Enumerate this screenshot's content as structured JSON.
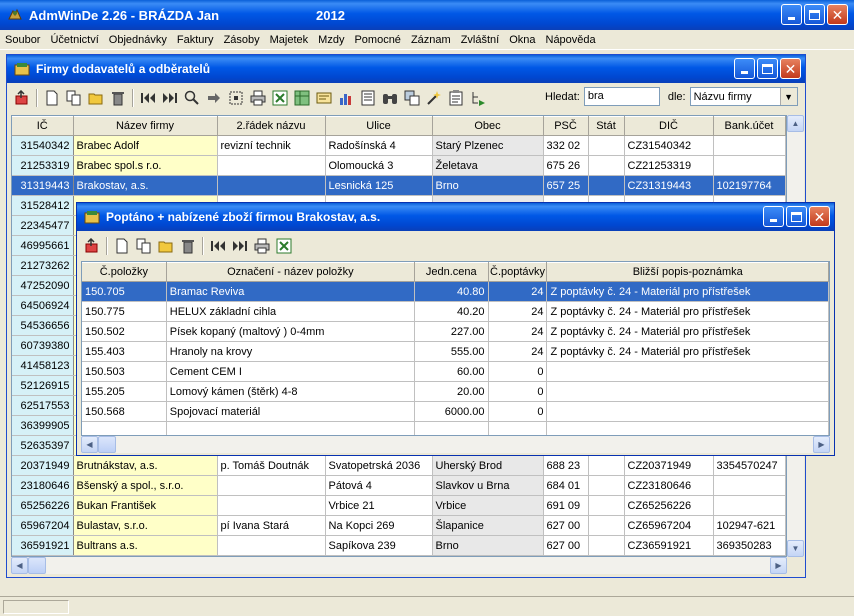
{
  "app": {
    "title": "AdmWinDe 2.26 - BRÁZDA Jan",
    "year": "2012"
  },
  "menu": [
    "Soubor",
    "Účetnictví",
    "Objednávky",
    "Faktury",
    "Zásoby",
    "Majetek",
    "Mzdy",
    "Pomocné",
    "Záznam",
    "Zvláštní",
    "Okna",
    "Nápověda"
  ],
  "firms_window": {
    "title": "Firmy dodavatelů a odběratelů",
    "search_label": "Hledat:",
    "search_value": "bra",
    "by_label": "dle:",
    "by_value": "Názvu firmy",
    "columns": [
      "IČ",
      "Název firmy",
      "2.řádek názvu",
      "Ulice",
      "Obec",
      "PSČ",
      "Stát",
      "DIČ",
      "Bank.účet"
    ],
    "rows": [
      {
        "ic": "31540342",
        "name": "Brabec Adolf",
        "line2": "revizní technik",
        "street": "Radošínská 4",
        "city": "Starý Plzenec",
        "psc": "332 02",
        "stat": "",
        "dic": "CZ31540342",
        "bank": "",
        "selected": false
      },
      {
        "ic": "21253319",
        "name": "Brabec spol.s r.o.",
        "line2": "",
        "street": "Olomoucká 3",
        "city": "Želetava",
        "psc": "675 26",
        "stat": "",
        "dic": "CZ21253319",
        "bank": "",
        "selected": false
      },
      {
        "ic": "31319443",
        "name": "Brakostav, a.s.",
        "line2": "",
        "street": "Lesnická 125",
        "city": "Brno",
        "psc": "657 25",
        "stat": "",
        "dic": "CZ31319443",
        "bank": "102197764",
        "selected": true
      },
      {
        "ic": "31528412",
        "name": "",
        "line2": "",
        "street": "",
        "city": "",
        "psc": "",
        "stat": "",
        "dic": "",
        "bank": "",
        "selected": false
      },
      {
        "ic": "22345477",
        "name": "",
        "line2": "",
        "street": "",
        "city": "",
        "psc": "",
        "stat": "",
        "dic": "",
        "bank": "",
        "selected": false
      },
      {
        "ic": "46995661",
        "name": "",
        "line2": "",
        "street": "",
        "city": "",
        "psc": "",
        "stat": "",
        "dic": "",
        "bank": "",
        "selected": false
      },
      {
        "ic": "21273262",
        "name": "",
        "line2": "",
        "street": "",
        "city": "",
        "psc": "",
        "stat": "",
        "dic": "",
        "bank": "",
        "selected": false
      },
      {
        "ic": "47252090",
        "name": "",
        "line2": "",
        "street": "",
        "city": "",
        "psc": "",
        "stat": "",
        "dic": "",
        "bank": "",
        "selected": false
      },
      {
        "ic": "64506924",
        "name": "",
        "line2": "",
        "street": "",
        "city": "",
        "psc": "",
        "stat": "",
        "dic": "",
        "bank": "",
        "selected": false
      },
      {
        "ic": "54536656",
        "name": "",
        "line2": "",
        "street": "",
        "city": "",
        "psc": "",
        "stat": "",
        "dic": "",
        "bank": "",
        "selected": false
      },
      {
        "ic": "60739380",
        "name": "",
        "line2": "",
        "street": "",
        "city": "",
        "psc": "",
        "stat": "",
        "dic": "",
        "bank": "",
        "selected": false
      },
      {
        "ic": "41458123",
        "name": "",
        "line2": "",
        "street": "",
        "city": "",
        "psc": "",
        "stat": "",
        "dic": "",
        "bank": "",
        "selected": false
      },
      {
        "ic": "52126915",
        "name": "",
        "line2": "",
        "street": "",
        "city": "",
        "psc": "",
        "stat": "",
        "dic": "",
        "bank": "",
        "selected": false
      },
      {
        "ic": "62517553",
        "name": "",
        "line2": "",
        "street": "",
        "city": "",
        "psc": "",
        "stat": "",
        "dic": "",
        "bank": "",
        "selected": false
      },
      {
        "ic": "36399905",
        "name": "",
        "line2": "",
        "street": "",
        "city": "",
        "psc": "",
        "stat": "",
        "dic": "",
        "bank": "",
        "selected": false
      },
      {
        "ic": "52635397",
        "name": "",
        "line2": "",
        "street": "",
        "city": "",
        "psc": "",
        "stat": "",
        "dic": "",
        "bank": "",
        "selected": false
      },
      {
        "ic": "20371949",
        "name": "Brutnákstav, a.s.",
        "line2": "p. Tomáš Doutnák",
        "street": "Svatopetrská 2036",
        "city": "Uherský Brod",
        "psc": "688 23",
        "stat": "",
        "dic": "CZ20371949",
        "bank": "3354570247",
        "selected": false
      },
      {
        "ic": "23180646",
        "name": "Bšenský a spol., s.r.o.",
        "line2": "",
        "street": "Pátová 4",
        "city": "Slavkov u Brna",
        "psc": "684 01",
        "stat": "",
        "dic": "CZ23180646",
        "bank": "",
        "selected": false
      },
      {
        "ic": "65256226",
        "name": "Bukan František",
        "line2": "",
        "street": "Vrbice 21",
        "city": "Vrbice",
        "psc": "691 09",
        "stat": "",
        "dic": "CZ65256226",
        "bank": "",
        "selected": false
      },
      {
        "ic": "65967204",
        "name": "Bulastav, s.r.o.",
        "line2": "pí Ivana Stará",
        "street": "Na Kopci 269",
        "city": "Šlapanice",
        "psc": "627 00",
        "stat": "",
        "dic": "CZ65967204",
        "bank": "102947-621",
        "selected": false
      },
      {
        "ic": "36591921",
        "name": "Bultrans a.s.",
        "line2": "",
        "street": "Sapíkova 239",
        "city": "Brno",
        "psc": "627 00",
        "stat": "",
        "dic": "CZ36591921",
        "bank": "369350283",
        "selected": false
      }
    ]
  },
  "goods_window": {
    "title": "Poptáno + nabízené zboží firmou Brakostav, a.s.",
    "columns": [
      "Č.položky",
      "Označení - název položky",
      "Jedn.cena",
      "Č.poptávky",
      "Bližší popis-poznámka"
    ],
    "rows": [
      {
        "code": "150.705",
        "name": "Bramac Reviva",
        "price": "40.80",
        "req": "24",
        "note": "Z poptávky č.      24 - Materiál pro přístřešek",
        "selected": true
      },
      {
        "code": "150.775",
        "name": "HELUX základní cihla",
        "price": "40.20",
        "req": "24",
        "note": "Z poptávky č.      24 - Materiál pro přístřešek",
        "selected": false
      },
      {
        "code": "150.502",
        "name": "Písek kopaný (maltový ) 0-4mm",
        "price": "227.00",
        "req": "24",
        "note": "Z poptávky č.      24 - Materiál pro přístřešek",
        "selected": false
      },
      {
        "code": "155.403",
        "name": "Hranoly na krovy",
        "price": "555.00",
        "req": "24",
        "note": "Z poptávky č.      24 - Materiál pro přístřešek",
        "selected": false
      },
      {
        "code": "150.503",
        "name": "Cement CEM I",
        "price": "60.00",
        "req": "0",
        "note": "",
        "selected": false
      },
      {
        "code": "155.205",
        "name": "Lomový kámen (štěrk) 4-8",
        "price": "20.00",
        "req": "0",
        "note": "",
        "selected": false
      },
      {
        "code": "150.568",
        "name": "Spojovací materiál",
        "price": "6000.00",
        "req": "0",
        "note": "",
        "selected": false
      },
      {
        "code": "",
        "name": "",
        "price": "",
        "req": "",
        "note": "",
        "selected": false
      }
    ]
  }
}
